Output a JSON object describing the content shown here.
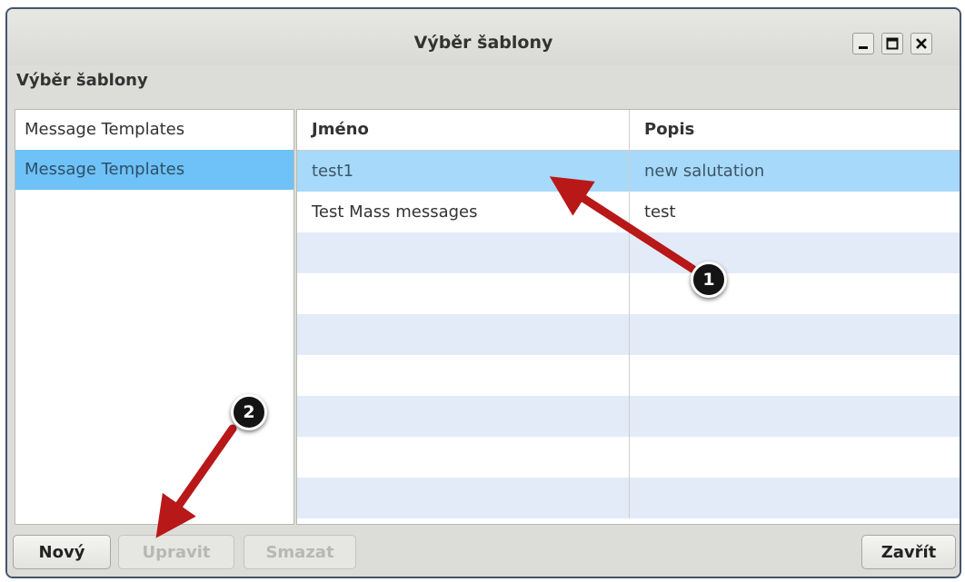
{
  "window": {
    "title": "Výběr šablony",
    "controls": [
      "minimize-icon",
      "maximize-icon",
      "close-icon"
    ]
  },
  "dialog": {
    "heading": "Výběr šablony"
  },
  "left_panel": {
    "items": [
      {
        "label": "Message Templates",
        "selected": false
      },
      {
        "label": "Message Templates",
        "selected": true
      }
    ]
  },
  "table": {
    "columns": [
      "Jméno",
      "Popis"
    ],
    "rows": [
      {
        "name": "test1",
        "description": "new salutation",
        "selected": true
      },
      {
        "name": "Test Mass messages",
        "description": "test",
        "selected": false
      }
    ]
  },
  "buttons": {
    "new": "Nový",
    "edit": "Upravit",
    "delete": "Smazat",
    "close": "Zavřít"
  },
  "annotations": {
    "markers": [
      "1",
      "2"
    ],
    "arrow_color": "#b81818"
  },
  "colors": {
    "selection_left": "#6ec2f7",
    "selection_row": "#a7d9fb",
    "alt_row": "#e3ebf8",
    "frame_border": "#43556a"
  }
}
